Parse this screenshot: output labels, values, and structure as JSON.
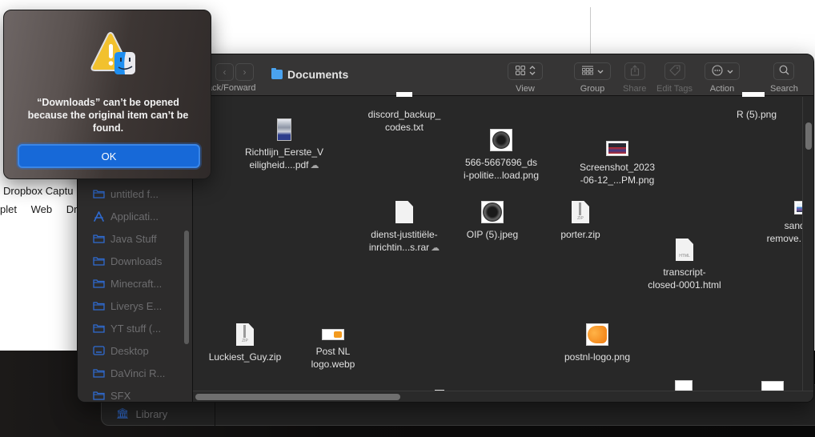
{
  "background_app": {
    "line1": "Dropbox Captu",
    "line2": [
      "plet",
      "Web",
      "Dro"
    ]
  },
  "alert": {
    "message": "“Downloads” can’t be opened because the original item can’t be found.",
    "ok_label": "OK",
    "icon": "warning-finder-icon"
  },
  "finder": {
    "title": "Documents",
    "nav_label": "Back/Forward",
    "nav_label_visible": "ack/Forward",
    "toolbar": [
      {
        "id": "view",
        "label": "View",
        "icon": "grid-icon",
        "enabled": true
      },
      {
        "id": "group",
        "label": "Group",
        "icon": "group-icon",
        "enabled": true
      },
      {
        "id": "share",
        "label": "Share",
        "icon": "share-icon",
        "enabled": false
      },
      {
        "id": "edit-tags",
        "label": "Edit Tags",
        "icon": "tag-icon",
        "enabled": false
      },
      {
        "id": "action",
        "label": "Action",
        "icon": "ellipsis-circle-icon",
        "enabled": true
      },
      {
        "id": "search",
        "label": "Search",
        "icon": "search-icon",
        "enabled": true
      }
    ],
    "sidebar": [
      {
        "label": "untitled f...",
        "icon": "folder-icon"
      },
      {
        "label": "Applicati...",
        "icon": "applications-icon"
      },
      {
        "label": "Java Stuff",
        "icon": "folder-icon"
      },
      {
        "label": "Downloads",
        "icon": "folder-icon"
      },
      {
        "label": "Minecraft...",
        "icon": "folder-icon"
      },
      {
        "label": "Liverys E...",
        "icon": "folder-icon"
      },
      {
        "label": "YT stuff (...",
        "icon": "folder-icon"
      },
      {
        "label": "Desktop",
        "icon": "desktop-icon"
      },
      {
        "label": "DaVinci R...",
        "icon": "folder-icon"
      },
      {
        "label": "SFX",
        "icon": "folder-icon"
      }
    ],
    "library_item": "Library",
    "files": [
      {
        "name": "Richtlijn_Eerste_V eiligheid....pdf",
        "line1": "Richtlijn_Eerste_V",
        "line2": "eiligheid....pdf",
        "cloud": true,
        "kind": "pdf"
      },
      {
        "name": "discord_backup_codes.txt",
        "line1": "discord_backup_",
        "line2": "codes.txt",
        "cloud": false,
        "kind": "txt"
      },
      {
        "name": "566-5667696_dsi-politie...load.png",
        "line1": "566-5667696_ds",
        "line2": "i-politie...load.png",
        "cloud": false,
        "kind": "badge"
      },
      {
        "name": "Screenshot_2023-06-12_...PM.png",
        "line1": "Screenshot_2023",
        "line2": "-06-12_...PM.png",
        "cloud": false,
        "kind": "screenshot"
      },
      {
        "name": "R (5).png",
        "line1": "R (5).png",
        "line2": "",
        "cloud": false,
        "kind": "image"
      },
      {
        "name": "dienst-justitiële-inrichtin...s.rar",
        "line1": "dienst-justitiële-",
        "line2": "inrichtin...s.rar",
        "cloud": true,
        "kind": "doc"
      },
      {
        "name": "OIP (5).jpeg",
        "line1": "OIP (5).jpeg",
        "line2": "",
        "cloud": false,
        "kind": "badge"
      },
      {
        "name": "porter.zip",
        "line1": "porter.zip",
        "line2": "",
        "cloud": false,
        "kind": "zip"
      },
      {
        "name": "transcript-closed-0001.html",
        "line1": "transcript-",
        "line2": "closed-0001.html",
        "cloud": false,
        "kind": "html"
      },
      {
        "name": "sandiego-remove...view.png",
        "line1": "sandiego-",
        "line2": "remove...view.png",
        "cloud": false,
        "kind": "skyline"
      },
      {
        "name": "san remove",
        "line1": "san",
        "line2": "remove",
        "cloud": false,
        "kind": "partial"
      },
      {
        "name": "Luckiest_Guy.zip",
        "line1": "Luckiest_Guy.zip",
        "line2": "",
        "cloud": false,
        "kind": "zip"
      },
      {
        "name": "Post NL logo.webp",
        "line1": "Post NL",
        "line2": "logo.webp",
        "cloud": false,
        "kind": "postnl-small"
      },
      {
        "name": "postnl-logo.png",
        "line1": "postnl-logo.png",
        "line2": "",
        "cloud": false,
        "kind": "postnl"
      }
    ],
    "zip_badge": "ZIP",
    "html_badge": "HTML"
  }
}
